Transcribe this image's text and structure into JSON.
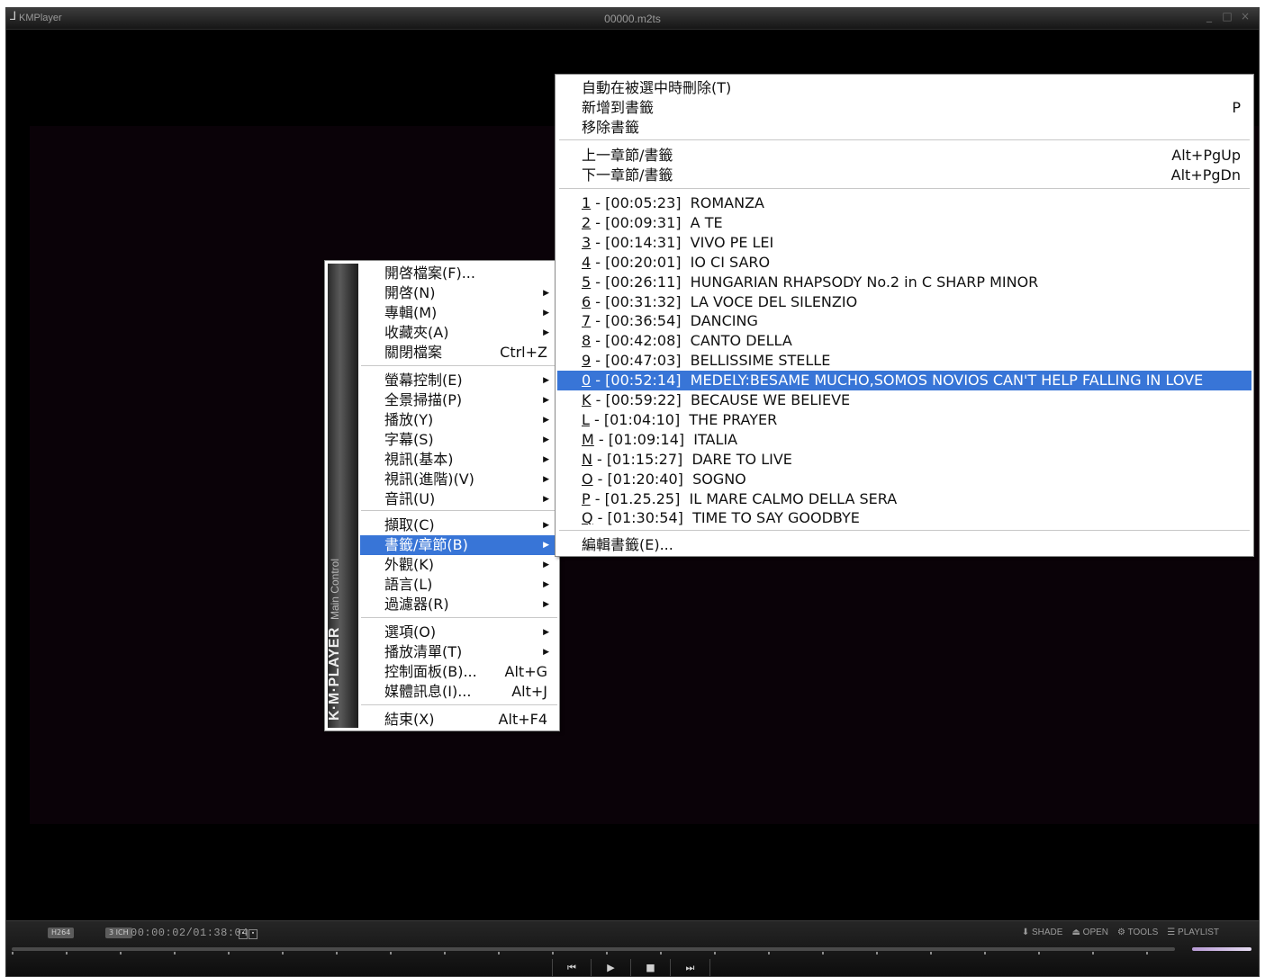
{
  "window": {
    "app_name": "KMPlayer",
    "file_title": "00000.m2ts",
    "controls": [
      "_",
      "□",
      "×"
    ]
  },
  "status": {
    "video_codec": "H264",
    "audio_codec": "3 ICH",
    "time": "00:00:02/01:38:04",
    "tools": {
      "shade": "SHADE",
      "open": "OPEN",
      "tools": "TOOLS",
      "playlist": "PLAYLIST"
    }
  },
  "transport": [
    "⏮",
    "▶",
    "■",
    "⏭"
  ],
  "main_menu": {
    "banner_brand": "K·M·PLAYER",
    "banner_sub": "Main Control",
    "items": [
      {
        "label": "開啓檔案(F)...",
        "shortcut": "",
        "arrow": false
      },
      {
        "label": "開啓(N)",
        "shortcut": "",
        "arrow": true
      },
      {
        "label": "專輯(M)",
        "shortcut": "",
        "arrow": true
      },
      {
        "label": "收藏夾(A)",
        "shortcut": "",
        "arrow": true
      },
      {
        "label": "關閉檔案",
        "shortcut": "Ctrl+Z",
        "arrow": false
      },
      {
        "label": "螢幕控制(E)",
        "shortcut": "",
        "arrow": true
      },
      {
        "label": "全景掃描(P)",
        "shortcut": "",
        "arrow": true
      },
      {
        "label": "播放(Y)",
        "shortcut": "",
        "arrow": true
      },
      {
        "label": "字幕(S)",
        "shortcut": "",
        "arrow": true
      },
      {
        "label": "視訊(基本)",
        "shortcut": "",
        "arrow": true
      },
      {
        "label": "視訊(進階)(V)",
        "shortcut": "",
        "arrow": true
      },
      {
        "label": "音訊(U)",
        "shortcut": "",
        "arrow": true
      },
      {
        "label": "擷取(C)",
        "shortcut": "",
        "arrow": true
      },
      {
        "label": "書籤/章節(B)",
        "shortcut": "",
        "arrow": true,
        "highlighted": true
      },
      {
        "label": "外觀(K)",
        "shortcut": "",
        "arrow": true
      },
      {
        "label": "語言(L)",
        "shortcut": "",
        "arrow": true
      },
      {
        "label": "過濾器(R)",
        "shortcut": "",
        "arrow": true
      },
      {
        "label": "選項(O)",
        "shortcut": "",
        "arrow": true
      },
      {
        "label": "播放清單(T)",
        "shortcut": "",
        "arrow": true
      },
      {
        "label": "控制面板(B)...",
        "shortcut": "Alt+G",
        "arrow": false
      },
      {
        "label": "媒體訊息(I)...",
        "shortcut": "Alt+J",
        "arrow": false
      },
      {
        "label": "結束(X)",
        "shortcut": "Alt+F4",
        "arrow": false
      }
    ]
  },
  "bookmark_menu": {
    "top_items": [
      {
        "label": "自動在被選中時刪除(T)",
        "shortcut": ""
      },
      {
        "label": "新增到書籤",
        "shortcut": "P"
      },
      {
        "label": "移除書籤",
        "shortcut": ""
      }
    ],
    "nav_items": [
      {
        "label": "上一章節/書籤",
        "shortcut": "Alt+PgUp"
      },
      {
        "label": "下一章節/書籤",
        "shortcut": "Alt+PgDn"
      }
    ],
    "chapters": [
      {
        "key": "1",
        "time": "[00:05:23]",
        "title": "ROMANZA"
      },
      {
        "key": "2",
        "time": "[00:09:31]",
        "title": "A TE"
      },
      {
        "key": "3",
        "time": "[00:14:31]",
        "title": "VIVO PE LEI"
      },
      {
        "key": "4",
        "time": "[00:20:01]",
        "title": "IO CI SARO"
      },
      {
        "key": "5",
        "time": "[00:26:11]",
        "title": "HUNGARIAN RHAPSODY No.2 in C SHARP MINOR"
      },
      {
        "key": "6",
        "time": "[00:31:32]",
        "title": "LA VOCE DEL SILENZIO"
      },
      {
        "key": "7",
        "time": "[00:36:54]",
        "title": "DANCING"
      },
      {
        "key": "8",
        "time": "[00:42:08]",
        "title": "CANTO DELLA"
      },
      {
        "key": "9",
        "time": "[00:47:03]",
        "title": "BELLISSIME STELLE"
      },
      {
        "key": "0",
        "time": "[00:52:14]",
        "title": "MEDELY:BESAME MUCHO,SOMOS NOVIOS CAN'T HELP FALLING IN LOVE",
        "highlighted": true
      },
      {
        "key": "K",
        "time": "[00:59:22]",
        "title": "BECAUSE WE BELIEVE"
      },
      {
        "key": "L",
        "time": "[01:04:10]",
        "title": "THE PRAYER"
      },
      {
        "key": "M",
        "time": "[01:09:14]",
        "title": "ITALIA"
      },
      {
        "key": "N",
        "time": "[01:15:27]",
        "title": "DARE TO LIVE"
      },
      {
        "key": "O",
        "time": "[01:20:40]",
        "title": "SOGNO"
      },
      {
        "key": "P",
        "time": "[01.25.25]",
        "title": "IL MARE CALMO DELLA SERA"
      },
      {
        "key": "Q",
        "time": "[01:30:54]",
        "title": "TIME TO SAY GOODBYE"
      }
    ],
    "edit_item": "編輯書籤(E)..."
  }
}
